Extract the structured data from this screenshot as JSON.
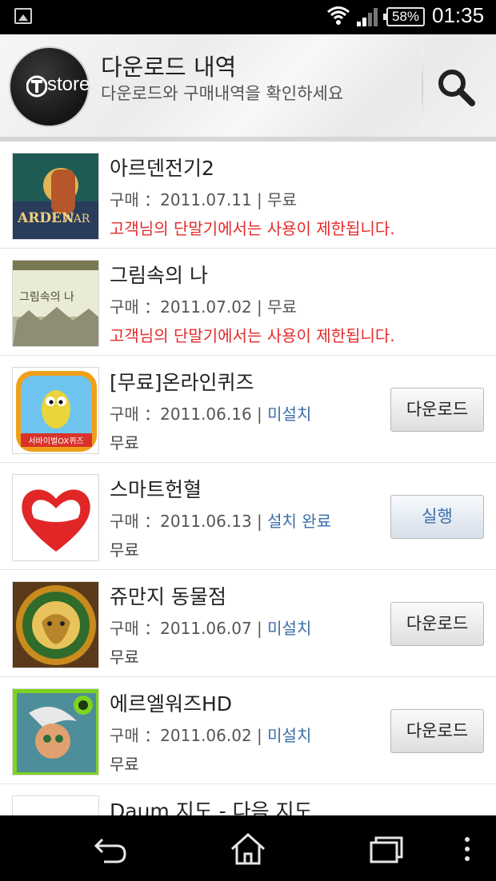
{
  "status_bar": {
    "battery": "58%",
    "time": "01:35",
    "icons": [
      "gallery-icon",
      "wifi-icon",
      "signal-icon",
      "battery-icon"
    ]
  },
  "header": {
    "logo_text": "store",
    "title": "다운로드 내역",
    "subtitle": "다운로드와 구매내역을 확인하세요",
    "search_icon": "search-icon"
  },
  "labels": {
    "purchase_prefix": "구매 ："
  },
  "apps": [
    {
      "name": "아르덴전기2",
      "date": "2011.07.11",
      "status": "무료",
      "line3": "고객님의 단말기에서는 사용이 제한됩니다.",
      "button": ""
    },
    {
      "name": "그림속의 나",
      "date": "2011.07.02",
      "status": "무료",
      "line3": "고객님의 단말기에서는 사용이 제한됩니다.",
      "button": ""
    },
    {
      "name": "[무료]온라인퀴즈",
      "date": "2011.06.16",
      "status": "미설치",
      "line3": "무료",
      "button": "다운로드"
    },
    {
      "name": "스마트헌혈",
      "date": "2011.06.13",
      "status": "설치 완료",
      "line3": "무료",
      "button": "실행"
    },
    {
      "name": "쥬만지 동물점",
      "date": "2011.06.07",
      "status": "미설치",
      "line3": "무료",
      "button": "다운로드"
    },
    {
      "name": "에르엘워즈HD",
      "date": "2011.06.02",
      "status": "미설치",
      "line3": "무료",
      "button": "다운로드"
    },
    {
      "name": "Daum 지도 - 다음 지도",
      "date": "",
      "status": "",
      "line3": "",
      "button": ""
    }
  ],
  "thumb_art": {
    "0": "game-art-thumbnail",
    "1": "sketch-art-thumbnail",
    "2": "bee-character-thumbnail",
    "3": "red-heart-thumbnail",
    "4": "lion-thumbnail",
    "5": "character-thumbnail",
    "6": "daum-map-thumbnail"
  },
  "thumb_text": {
    "arden": "ARDEN",
    "arden_war": "WAR",
    "sketch": "그림속의 나",
    "quiz": "서바이벌OX퀴즈"
  },
  "nav_bar": {
    "icons": [
      "back-icon",
      "home-icon",
      "recent-apps-icon",
      "menu-icon"
    ]
  },
  "colors": {
    "warning": "#e52b2b",
    "status_link": "#3b6da8",
    "status_bar_bg": "#000000"
  }
}
